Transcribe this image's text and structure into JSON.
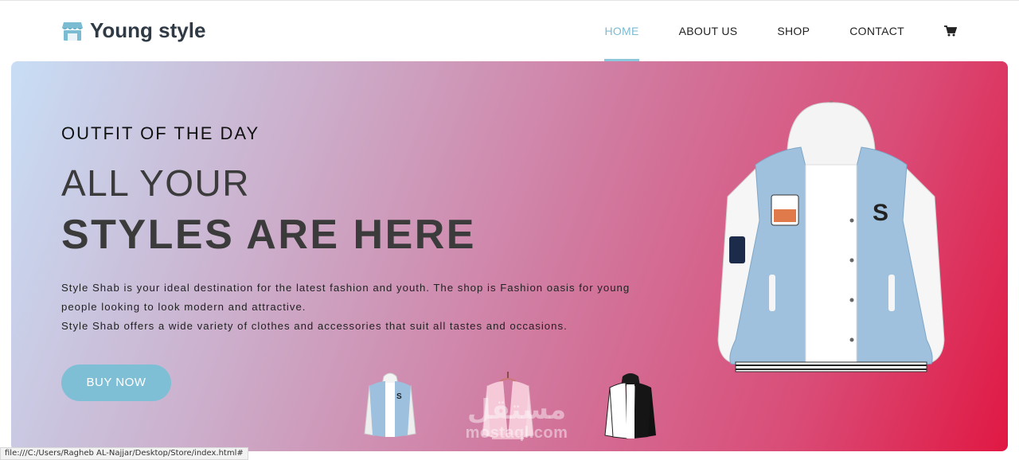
{
  "header": {
    "brand_icon": "store-icon",
    "brand_name": "Young style",
    "nav": [
      {
        "label": "HOME",
        "active": true
      },
      {
        "label": "ABOUT US",
        "active": false
      },
      {
        "label": "SHOP",
        "active": false
      },
      {
        "label": "CONTACT",
        "active": false
      }
    ],
    "cart_icon": "cart-icon"
  },
  "hero": {
    "eyebrow": "OUTFIT OF THE DAY",
    "title_light": "ALL YOUR",
    "title_bold": "STYLES ARE HERE",
    "description": [
      "Style Shab is your ideal destination for the latest fashion and youth. The shop is Fashion oasis for young",
      "people looking to look modern and attractive.",
      "Style Shab offers a wide variety of clothes and accessories that suit all tastes and occasions."
    ],
    "cta_label": "BUY NOW",
    "main_image": "blue-varsity-jacket-image",
    "thumbnails": [
      {
        "name": "blue-jacket-thumbnail"
      },
      {
        "name": "pink-jacket-thumbnail"
      },
      {
        "name": "black-jacket-thumbnail"
      }
    ]
  },
  "watermark": {
    "arabic": "مستقل",
    "latin": "mostaql.com"
  },
  "status_bar": "file:///C:/Users/Ragheb AL-Najjar/Desktop/Store/index.html#",
  "colors": {
    "accent": "#7fbfd6",
    "gradient_start": "#c8def5",
    "gradient_end": "#e01843",
    "text_dark": "#3b3b3b"
  }
}
